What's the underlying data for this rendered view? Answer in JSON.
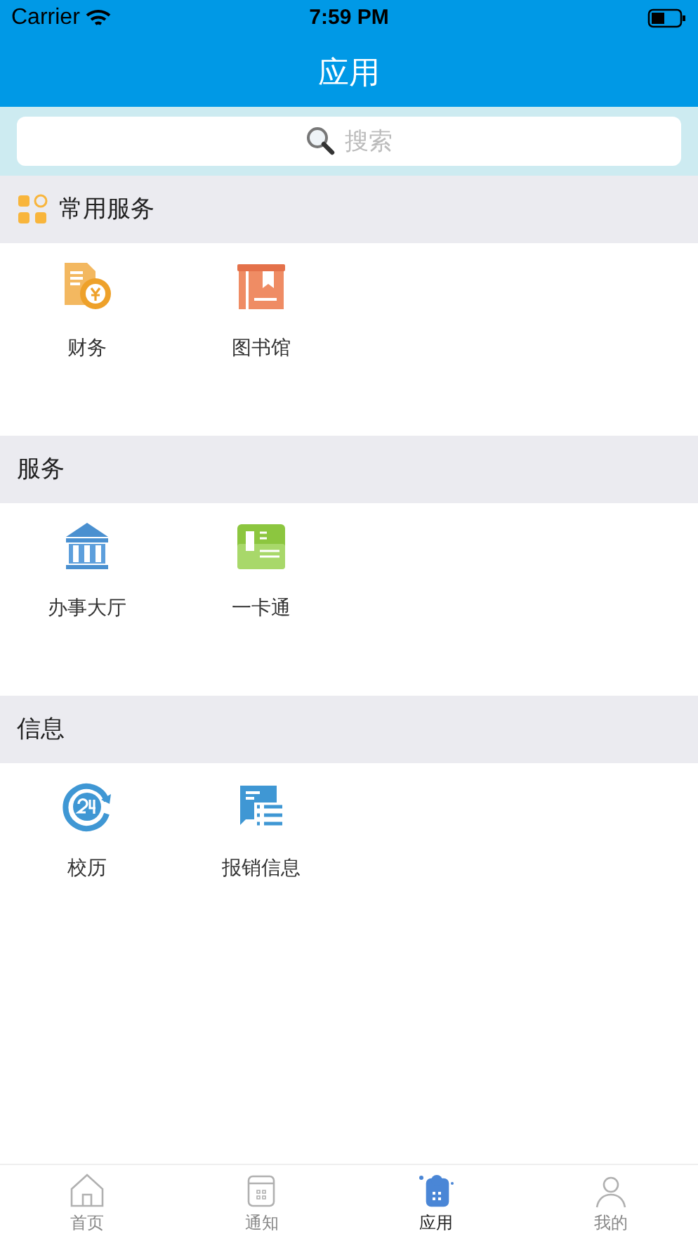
{
  "status_bar": {
    "carrier": "Carrier",
    "time": "7:59 PM"
  },
  "header": {
    "title": "应用"
  },
  "search": {
    "placeholder": "搜索"
  },
  "sections": [
    {
      "title": "常用服务",
      "has_icon": true,
      "items": [
        {
          "kind": "finance",
          "label": "财务"
        },
        {
          "kind": "library",
          "label": "图书馆"
        }
      ]
    },
    {
      "title": "服务",
      "has_icon": false,
      "items": [
        {
          "kind": "hall",
          "label": "办事大厅"
        },
        {
          "kind": "card",
          "label": "一卡通"
        }
      ]
    },
    {
      "title": "信息",
      "has_icon": false,
      "items": [
        {
          "kind": "calendar",
          "label": "校历"
        },
        {
          "kind": "list",
          "label": "报销信息"
        }
      ]
    }
  ],
  "tabs": [
    {
      "kind": "home",
      "label": "首页",
      "selected": false
    },
    {
      "kind": "notice",
      "label": "通知",
      "selected": false
    },
    {
      "kind": "apps",
      "label": "应用",
      "selected": true
    },
    {
      "kind": "profile",
      "label": "我的",
      "selected": false
    }
  ]
}
